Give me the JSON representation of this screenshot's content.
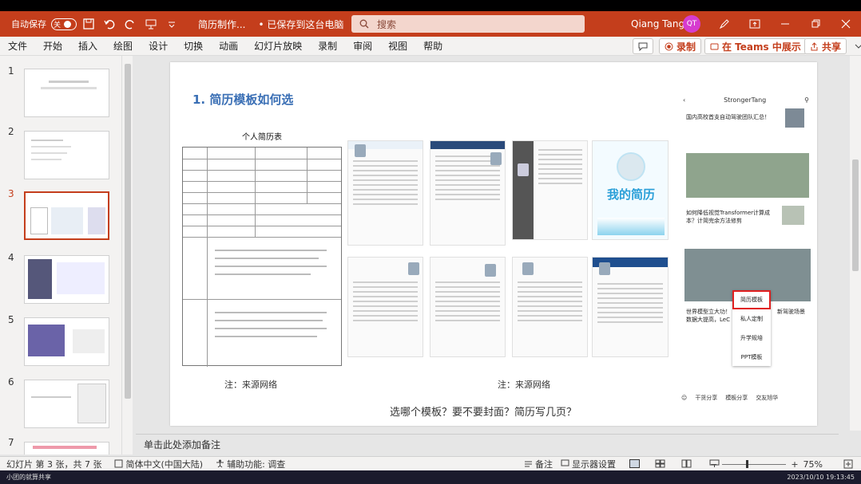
{
  "titlebar": {
    "autosave_label": "自动保存",
    "autosave_state": "关",
    "doc_title": "简历制作...",
    "save_state": "• 已保存到这台电脑",
    "search_placeholder": "搜索",
    "user_name": "Qiang Tang",
    "user_initials": "QT"
  },
  "menu": {
    "items": [
      "文件",
      "开始",
      "插入",
      "绘图",
      "设计",
      "切换",
      "动画",
      "幻灯片放映",
      "录制",
      "审阅",
      "视图",
      "帮助"
    ],
    "record_label": "录制",
    "teams_label": "在 Teams 中展示",
    "share_label": "共享"
  },
  "thumbnails": {
    "numbers": [
      "1",
      "2",
      "3",
      "4",
      "5",
      "6",
      "7"
    ],
    "active": 3
  },
  "slide": {
    "title": "1.   简历模板如何选",
    "table_title": "个人简历表",
    "caption_left": "注：来源网络",
    "caption_right": "注：来源网络",
    "bottom_text": "选哪个模板？要不要封面？简历写几页？",
    "cute_template_text": "我的简历"
  },
  "panel": {
    "header": "StrongerTang",
    "news1": "国内高校首支自动驾驶团队汇总！",
    "news2": "如何降低视觉Transformer计算成本？计简完余方法修剪",
    "news3": "世界模型立大功！数据大提高，LeC",
    "news3b": "新驾驶场景",
    "popup_items": [
      "简历模板",
      "私人定制",
      "升学规培",
      "PPT模板"
    ],
    "footer_items": [
      "干货分享",
      "模板分享",
      "交友旭华"
    ]
  },
  "notes": {
    "placeholder": "单击此处添加备注"
  },
  "status": {
    "slide_info": "幻灯片 第 3 张，共 7 张",
    "language": "简体中文(中国大陆)",
    "accessibility": "辅助功能: 调查",
    "notes_label": "备注",
    "display_settings": "显示器设置",
    "zoom": "75%"
  },
  "taskbar": {
    "app_label": "小团的就算共享",
    "datetime": "2023/10/10 19:13:45"
  },
  "colors": {
    "accent": "#c43e1c",
    "title_blue": "#3a6fb5"
  }
}
